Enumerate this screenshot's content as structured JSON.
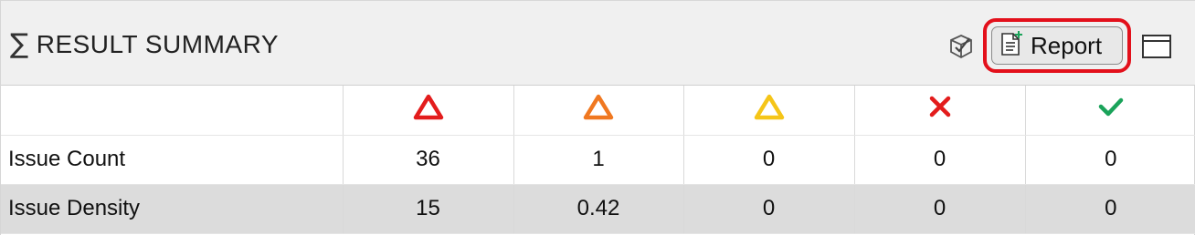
{
  "header": {
    "title": "RESULT SUMMARY",
    "title_icon": "sigma-icon",
    "toolbar": {
      "cube_icon": "cube-check-icon",
      "report_icon": "report-add-icon",
      "report_label": "Report",
      "window_icon": "window-maximize-icon",
      "highlight_color": "#e3101b"
    }
  },
  "table": {
    "columns": [
      {
        "icon": "triangle-red-icon",
        "color": "#e31c1c"
      },
      {
        "icon": "triangle-orange-icon",
        "color": "#f07820"
      },
      {
        "icon": "triangle-yellow-icon",
        "color": "#f5c518"
      },
      {
        "icon": "cross-icon",
        "color": "#e31c1c"
      },
      {
        "icon": "check-icon",
        "color": "#1aa35a"
      }
    ],
    "rows": [
      {
        "label": "Issue Count",
        "values": [
          "36",
          "1",
          "0",
          "0",
          "0"
        ]
      },
      {
        "label": "Issue Density",
        "values": [
          "15",
          "0.42",
          "0",
          "0",
          "0"
        ]
      }
    ]
  }
}
